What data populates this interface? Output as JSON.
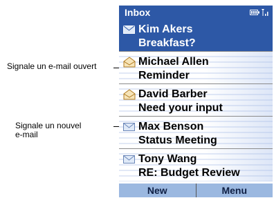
{
  "callouts": {
    "opened": "Signale un e-mail ouvert",
    "new_line1": "Signale un nouvel",
    "new_line2": "e-mail"
  },
  "titlebar": {
    "title": "Inbox",
    "icons": [
      "battery-icon",
      "signal-icon"
    ]
  },
  "messages": [
    {
      "sender": "Kim Akers",
      "subject": "Breakfast?",
      "icon": "mail-closed-icon",
      "selected": true
    },
    {
      "sender": "Michael Allen",
      "subject": "Reminder",
      "icon": "mail-open-icon",
      "selected": false
    },
    {
      "sender": "David Barber",
      "subject": "Need your input",
      "icon": "mail-open-icon",
      "selected": false
    },
    {
      "sender": "Max Benson",
      "subject": "Status Meeting",
      "icon": "mail-closed-icon",
      "selected": false
    },
    {
      "sender": "Tony Wang",
      "subject": "RE: Budget Review",
      "icon": "mail-closed-icon",
      "selected": false
    }
  ],
  "softkeys": {
    "left": "New",
    "right": "Menu"
  },
  "colors": {
    "accent": "#2d58a6",
    "softbar": "#9bb8e0"
  }
}
